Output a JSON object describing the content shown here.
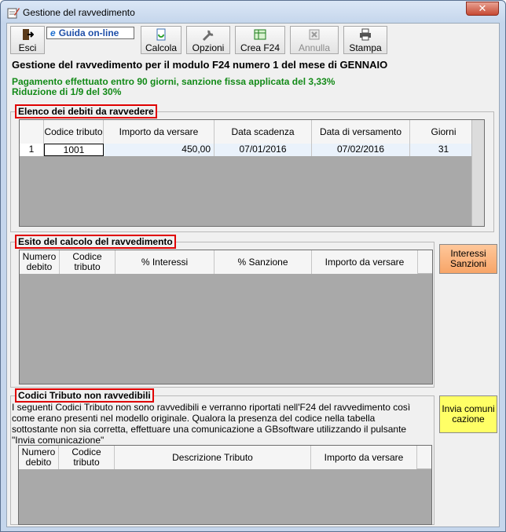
{
  "window": {
    "title": "Gestione del ravvedimento",
    "close_label": "✕"
  },
  "toolbar": {
    "esci": "Esci",
    "help": "Guida on-line",
    "calcola": "Calcola",
    "opzioni": "Opzioni",
    "crea": "Crea F24",
    "annulla": "Annulla",
    "stampa": "Stampa"
  },
  "header": {
    "title": "Gestione del ravvedimento per il modulo F24 numero 1 del mese di GENNAIO",
    "line1": "Pagamento effettuato entro 90 giorni, sanzione fissa applicata del 3,33%",
    "line2": "Riduzione di 1/9 del 30%"
  },
  "debiti": {
    "label": "Elenco dei debiti da ravvedere",
    "columns": [
      "Codice tributo",
      "Importo da versare",
      "Data scadenza",
      "Data di versamento",
      "Giorni"
    ],
    "rows": [
      {
        "n": "1",
        "codice": "1001",
        "importo": "450,00",
        "scadenza": "07/01/2016",
        "versamento": "07/02/2016",
        "giorni": "31"
      }
    ]
  },
  "esito": {
    "label": "Esito del calcolo del ravvedimento",
    "columns": [
      "Numero debito",
      "Codice tributo",
      "% Interessi",
      "% Sanzione",
      "Importo da versare"
    ],
    "button": "Interessi Sanzioni"
  },
  "codici": {
    "label": "Codici Tributo non ravvedibili",
    "text": "I seguenti Codici Tributo non sono ravvedibili e verranno riportati nell'F24 del ravvedimento così come erano presenti nel modello originale. Qualora la presenza del codice nella tabella sottostante non sia corretta, effettuare una comunicazione a GBsoftware utilizzando il pulsante \"Invia comunicazione\"",
    "columns": [
      "Numero debito",
      "Codice tributo",
      "Descrizione Tributo",
      "Importo da versare"
    ],
    "button": "Invia comuni cazione"
  },
  "icons": {
    "title": "edit-form-icon",
    "esci": "exit-icon",
    "calcola": "calculate-icon",
    "opzioni": "wrench-icon",
    "crea": "spreadsheet-icon",
    "annulla": "cancel-icon",
    "stampa": "printer-icon"
  },
  "colors": {
    "accent_green": "#138a18",
    "label_border": "#e00000",
    "btn_orange": "#f7a568",
    "btn_yellow": "#ffff66"
  }
}
